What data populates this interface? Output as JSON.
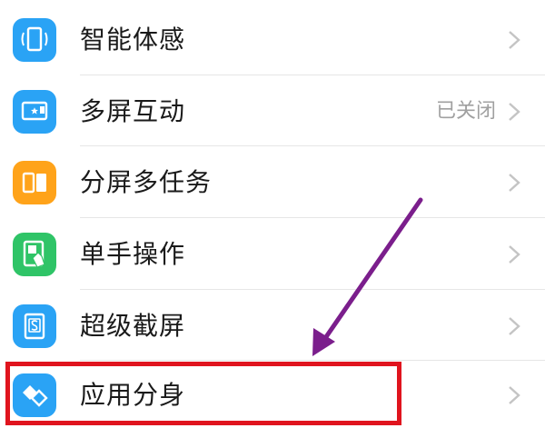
{
  "settings": {
    "items": [
      {
        "label": "智能体感",
        "value": "",
        "icon": "phone-motion-icon"
      },
      {
        "label": "多屏互动",
        "value": "已关闭",
        "icon": "screen-cast-icon"
      },
      {
        "label": "分屏多任务",
        "value": "",
        "icon": "split-screen-icon"
      },
      {
        "label": "单手操作",
        "value": "",
        "icon": "one-hand-icon"
      },
      {
        "label": "超级截屏",
        "value": "",
        "icon": "screenshot-icon"
      },
      {
        "label": "应用分身",
        "value": "",
        "icon": "app-clone-icon"
      }
    ]
  },
  "colors": {
    "icon_blue": "#2aa3f5",
    "icon_orange": "#ffa31a",
    "icon_green": "#2fc467",
    "highlight_red": "#e0141e",
    "annotation_purple": "#7b1e8c"
  }
}
